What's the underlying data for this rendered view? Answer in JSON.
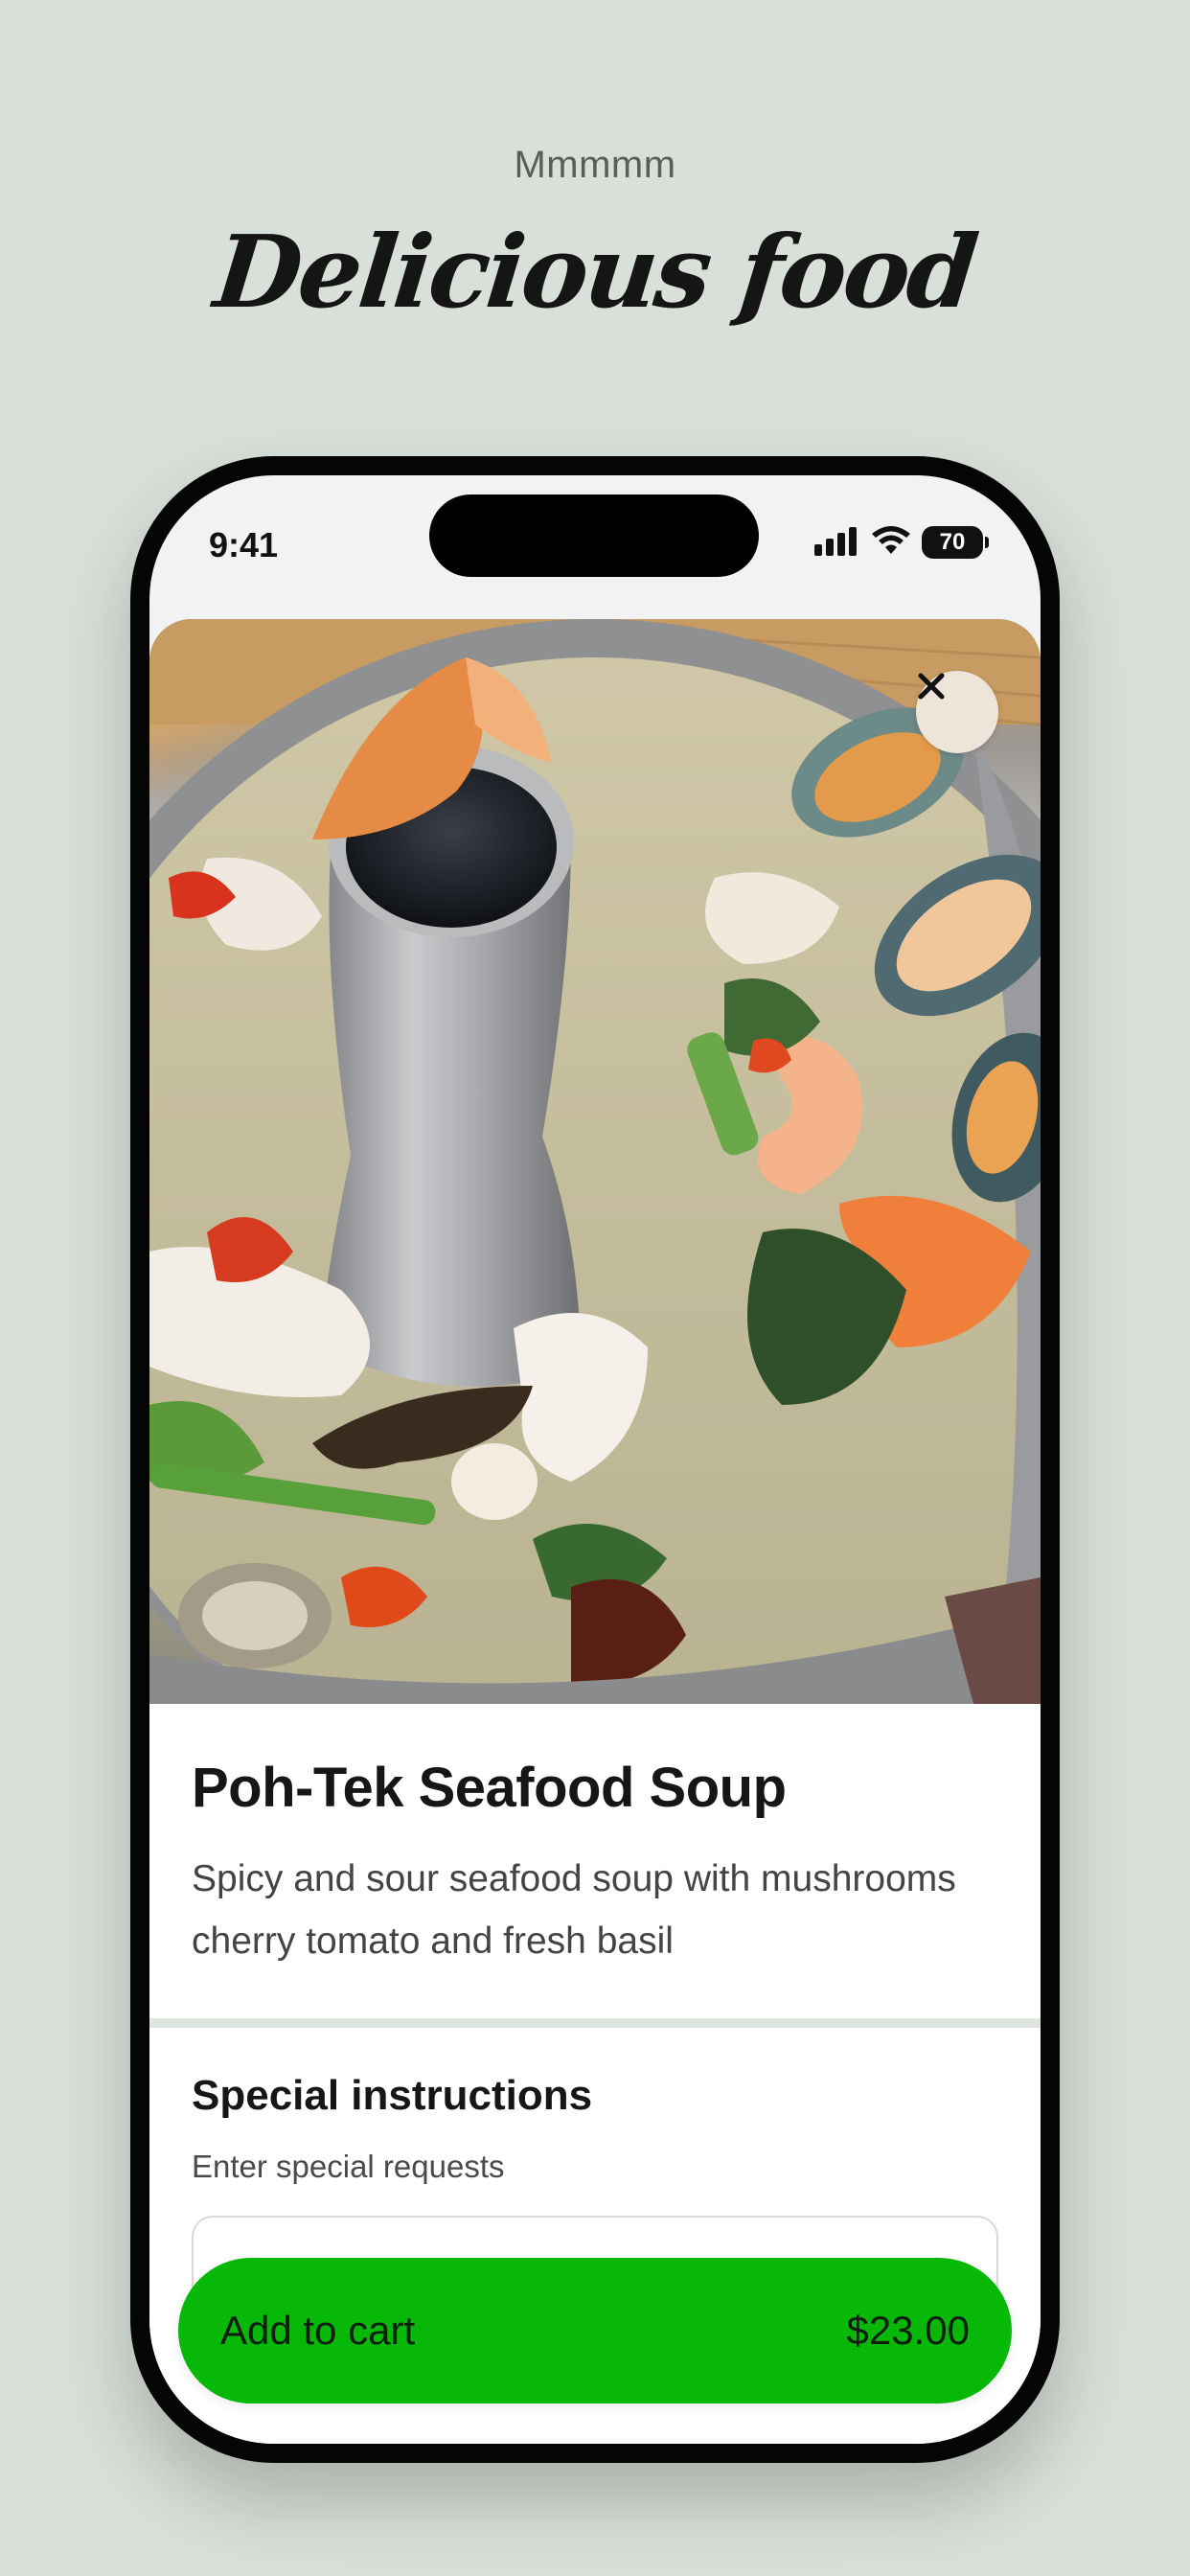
{
  "page": {
    "eyebrow": "Mmmmm",
    "title": "Delicious food",
    "background_color": "#d9e0d9"
  },
  "status_bar": {
    "time": "9:41",
    "battery": "70",
    "icons": [
      "signal-bars-icon",
      "wifi-icon",
      "battery-icon"
    ]
  },
  "dish": {
    "image_icon": "seafood-soup-photo",
    "close_icon": "close-icon",
    "name": "Poh-Tek Seafood Soup",
    "description": "Spicy and sour seafood soup with mushrooms cherry tomato and fresh basil"
  },
  "instructions": {
    "title": "Special instructions",
    "subtitle": "Enter special requests",
    "input_value": ""
  },
  "cart": {
    "label": "Add to cart",
    "price": "$23.00",
    "color": "#07b808"
  }
}
